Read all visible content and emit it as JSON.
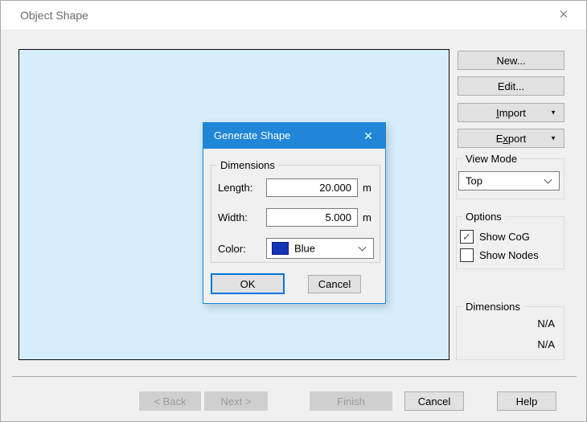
{
  "window": {
    "title": "Object Shape"
  },
  "icons": {
    "close": "✕",
    "dropdown_arrow": "▼",
    "check": "✓"
  },
  "sidebar": {
    "new_label": "New...",
    "edit_label": "Edit...",
    "import": {
      "pre": "",
      "key": "I",
      "rest": "mport"
    },
    "export": {
      "pre": "E",
      "key": "x",
      "rest": "port"
    },
    "view_mode": {
      "legend": "View Mode",
      "selected": "Top"
    },
    "options": {
      "legend": "Options",
      "items": [
        {
          "label": "Show CoG",
          "checked": true,
          "mark": "✓"
        },
        {
          "label": "Show Nodes",
          "checked": false,
          "mark": ""
        }
      ]
    },
    "dimensions": {
      "legend": "Dimensions",
      "rows": [
        "N/A",
        "N/A"
      ]
    }
  },
  "modal": {
    "title": "Generate Shape",
    "group_legend": "Dimensions",
    "fields": [
      {
        "label": "Length:",
        "value": "20.000",
        "unit": "m"
      },
      {
        "label": "Width:",
        "value": "5.000",
        "unit": "m"
      }
    ],
    "color": {
      "label": "Color:",
      "value": "Blue",
      "swatch_hex": "#1434b8"
    },
    "ok_label": "OK",
    "cancel_label": "Cancel"
  },
  "footer": {
    "back_label": "< Back",
    "next_label": "Next >",
    "finish_label": "Finish",
    "cancel_label": "Cancel",
    "help_label": "Help"
  },
  "colors": {
    "accent_blue": "#1f86d8",
    "focus_blue": "#0078d7",
    "canvas_blue": "#d6eefc",
    "swatch_blue": "#1434b8",
    "window_bg": "#f0f0f0"
  }
}
